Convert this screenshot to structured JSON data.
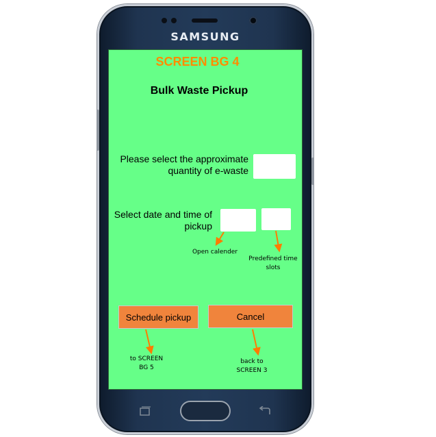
{
  "device": {
    "brand": "SAMSUNG"
  },
  "screen": {
    "screen_id": "SCREEN BG 4",
    "title": "Bulk Waste Pickup",
    "background_color": "#66ff88",
    "accent_color": "#ff8c00"
  },
  "quantity": {
    "label": "Please select the approximate quantity of e-waste",
    "value": ""
  },
  "schedule": {
    "label": "Select date and time of pickup",
    "date_value": "",
    "time_value": "",
    "date_note": "Open calender",
    "time_note": "Predefined time slots"
  },
  "buttons": {
    "schedule_label": "Schedule pickup",
    "cancel_label": "Cancel",
    "schedule_note": "to SCREEN BG 5",
    "cancel_note": "back to SCREEN 3",
    "button_color": "#f0843c"
  },
  "navbar": {
    "recent_icon": "recent-apps-icon",
    "home_icon": "home-button",
    "back_icon": "back-icon"
  }
}
